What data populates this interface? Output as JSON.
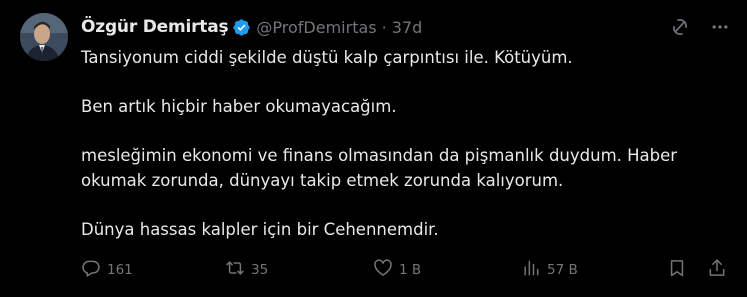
{
  "tweet": {
    "display_name": "Özgür Demirtaş",
    "handle": "@ProfDemirtas",
    "separator": "·",
    "time": "37d",
    "paragraphs": [
      "Tansiyonum ciddi şekilde düştü kalp çarpıntısı ile. Kötüyüm.",
      "Ben artık hiçbir haber okumayacağım.",
      "mesleğimin ekonomi ve finans olmasından da pişmanlık duydum. Haber okumak zorunda, dünyayı takip etmek zorunda kalıyorum.",
      "Dünya hassas kalpler için bir Cehennemdir."
    ]
  },
  "actions": {
    "replies": "161",
    "reposts": "35",
    "likes": "1 B",
    "views": "57 B"
  },
  "icons": {
    "verified": "verified-badge-icon",
    "grok": "grok-icon",
    "more": "more-icon",
    "reply": "reply-icon",
    "repost": "repost-icon",
    "like": "heart-icon",
    "views": "views-icon",
    "bookmark": "bookmark-icon",
    "share": "share-icon"
  },
  "colors": {
    "background": "#000000",
    "text": "#e7e9ea",
    "secondary": "#71767b",
    "verified": "#1d9bf0"
  }
}
